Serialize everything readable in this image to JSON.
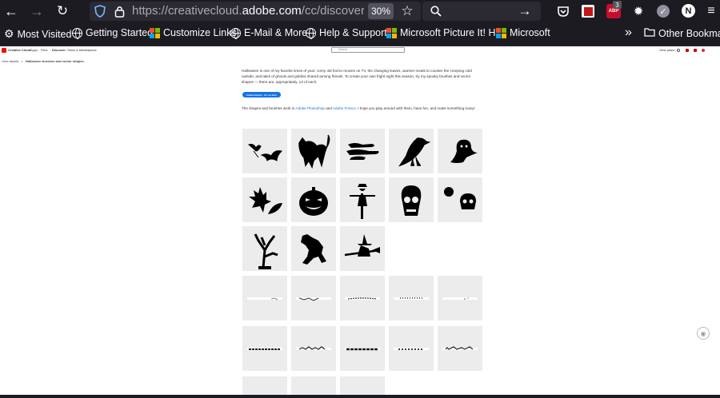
{
  "browser": {
    "url_prefix": "https://creativecloud.",
    "url_domain": "adobe.com",
    "url_path": "/cc/discover/article/ha",
    "zoom": "30%",
    "notification_badge": "3",
    "badge_label": "ABP",
    "profile_initial": "N"
  },
  "bookmarks": [
    {
      "label": "Most Visited",
      "icon": "gear-icon"
    },
    {
      "label": "Getting Started",
      "icon": "globe-icon"
    },
    {
      "label": "Customize Links",
      "icon": "microsoft-icon"
    },
    {
      "label": "E-Mail & More",
      "icon": "globe-icon"
    },
    {
      "label": "Help & Support",
      "icon": "globe-icon"
    },
    {
      "label": "Microsoft Picture It! H...",
      "icon": "microsoft-icon"
    },
    {
      "label": "Microsoft",
      "icon": "microsoft-icon"
    }
  ],
  "bookmarks_overflow": "»",
  "other_bookmarks": "Other Bookmarks",
  "cc": {
    "brand": "Creative Cloud",
    "nav": [
      "Apps",
      "Files",
      "Discover",
      "Stock & Marketplace"
    ],
    "search_placeholder": "Search",
    "view_plans": "View plans",
    "breadcrumb_parent": "View assets",
    "breadcrumb_sep": ">",
    "breadcrumb_current": "Halloween brushes and vector shapes."
  },
  "article": {
    "intro": "Halloween is one of my favorite times of year: corny old horror movies on TV, the changing leaves, warmer meals to counter the creeping cold outside, and tales of ghouls and goblins shared among friends. To create your own fright night this season, try my spooky brushes and vector shapes — there are, appropriately, 13 of each.",
    "follow_button": "Follow library - it's on dom",
    "note_before": "The shapes and brushes work in ",
    "link1": "Adobe Photoshop",
    "note_and": " and ",
    "link2": "Adobe Fresco",
    "note_after": ". I hope you play around with them, have fun, and make something scary!"
  },
  "shapes": [
    "bats",
    "cat",
    "clouds",
    "crow",
    "ghost",
    "leaves",
    "pumpkin",
    "scarecrow",
    "skull",
    "skulls",
    "tree",
    "werewolf",
    "witch"
  ],
  "brushes": [
    "brush-1",
    "brush-2",
    "brush-3",
    "brush-4",
    "brush-5",
    "brush-6",
    "brush-7",
    "brush-8",
    "brush-9",
    "brush-10"
  ],
  "colors": {
    "browser_bg": "#1c1b22",
    "url_bg": "#2b2a33",
    "link": "#1473e6",
    "tile_bg": "#ececec"
  }
}
